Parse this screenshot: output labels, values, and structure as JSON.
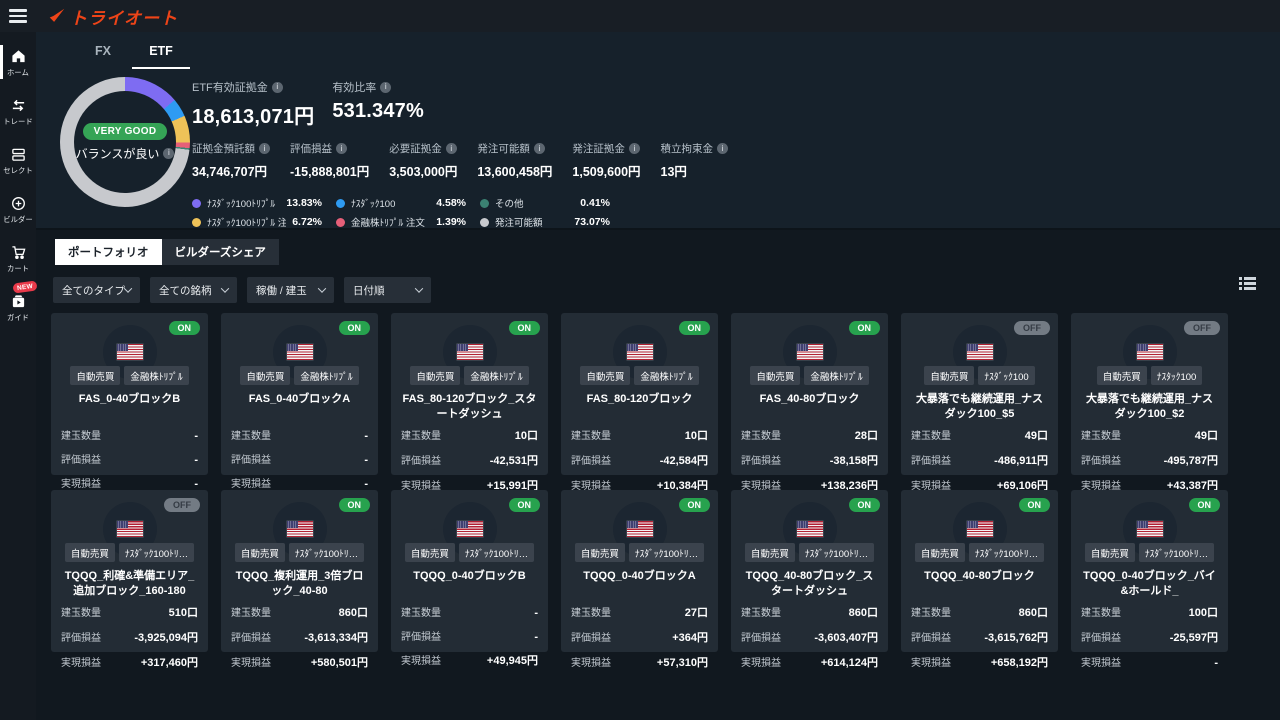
{
  "header": {
    "brand": "トライオート"
  },
  "sidebar": {
    "new_badge": "NEW",
    "items": [
      {
        "label": "ホーム"
      },
      {
        "label": "トレード"
      },
      {
        "label": "セレクト"
      },
      {
        "label": "ビルダー"
      },
      {
        "label": "カート"
      },
      {
        "label": "ガイド"
      }
    ]
  },
  "account": {
    "tabs": [
      {
        "label": "FX"
      },
      {
        "label": "ETF"
      }
    ],
    "gauge": {
      "badge": "VERY GOOD",
      "label": "バランスが良い"
    },
    "primary_stats": [
      {
        "label": "ETF有効証拠金",
        "value": "18,613,071円"
      },
      {
        "label": "有効比率",
        "value": "531.347%"
      }
    ],
    "secondary_stats": [
      {
        "label": "証拠金預託額",
        "value": "34,746,707円"
      },
      {
        "label": "評価損益",
        "value": "-15,888,801円"
      },
      {
        "label": "必要証拠金",
        "value": "3,503,000円"
      },
      {
        "label": "発注可能額",
        "value": "13,600,458円"
      },
      {
        "label": "発注証拠金",
        "value": "1,509,600円"
      },
      {
        "label": "積立拘束金",
        "value": "13円"
      }
    ],
    "legend": [
      {
        "label": "ﾅｽﾀﾞｯｸ100ﾄﾘﾌﾟﾙ",
        "value": "13.83%",
        "color": "#7e6cf2"
      },
      {
        "label": "ﾅｽﾀﾞｯｸ100ﾄﾘﾌﾟﾙ 注文",
        "value": "6.72%",
        "color": "#eec258"
      },
      {
        "label": "ﾅｽﾀﾞｯｸ100",
        "value": "4.58%",
        "color": "#2e9bf2"
      },
      {
        "label": "金融株ﾄﾘﾌﾟﾙ 注文",
        "value": "1.39%",
        "color": "#e55f78"
      },
      {
        "label": "その他",
        "value": "0.41%",
        "color": "#3b8172"
      },
      {
        "label": "発注可能額",
        "value": "73.07%",
        "color": "#c7c9cd"
      }
    ],
    "chart_data": {
      "type": "pie",
      "donut": true,
      "unit": "%",
      "center_badge": "VERY GOOD",
      "center_label": "バランスが良い",
      "segments": [
        {
          "label": "ﾅｽﾀﾞｯｸ100ﾄﾘﾌﾟﾙ",
          "value": 13.83,
          "color": "#7e6cf2"
        },
        {
          "label": "ﾅｽﾀﾞｯｸ100",
          "value": 4.58,
          "color": "#2e9bf2"
        },
        {
          "label": "ﾅｽﾀﾞｯｸ100ﾄﾘﾌﾟﾙ 注文",
          "value": 6.72,
          "color": "#eec258"
        },
        {
          "label": "金融株ﾄﾘﾌﾟﾙ 注文",
          "value": 1.39,
          "color": "#e55f78"
        },
        {
          "label": "その他",
          "value": 0.41,
          "color": "#3b8172"
        },
        {
          "label": "発注可能額",
          "value": 73.07,
          "color": "#c7c9cd"
        }
      ]
    }
  },
  "portfolio": {
    "tabs": [
      {
        "label": "ポートフォリオ"
      },
      {
        "label": "ビルダーズシェア"
      }
    ],
    "filters": [
      {
        "label": "全てのタイプ"
      },
      {
        "label": "全ての銘柄"
      },
      {
        "label": "稼働 / 建玉"
      },
      {
        "label": "日付順"
      }
    ],
    "auto_label": "自動売買",
    "stat_labels": {
      "qty": "建玉数量",
      "unrealized": "評価損益",
      "realized": "実現損益"
    },
    "cards": [
      {
        "status": "ON",
        "tag": "金融株ﾄﾘﾌﾟﾙ",
        "title": "FAS_0-40ブロックB",
        "qty": "-",
        "unrealized": "-",
        "realized": "-"
      },
      {
        "status": "ON",
        "tag": "金融株ﾄﾘﾌﾟﾙ",
        "title": "FAS_0-40ブロックA",
        "qty": "-",
        "unrealized": "-",
        "realized": "-"
      },
      {
        "status": "ON",
        "tag": "金融株ﾄﾘﾌﾟﾙ",
        "title": "FAS_80-120ブロック_スタートダッシュ",
        "qty": "10口",
        "unrealized": "-42,531円",
        "realized": "+15,991円"
      },
      {
        "status": "ON",
        "tag": "金融株ﾄﾘﾌﾟﾙ",
        "title": "FAS_80-120ブロック",
        "qty": "10口",
        "unrealized": "-42,584円",
        "realized": "+10,384円"
      },
      {
        "status": "ON",
        "tag": "金融株ﾄﾘﾌﾟﾙ",
        "title": "FAS_40-80ブロック",
        "qty": "28口",
        "unrealized": "-38,158円",
        "realized": "+138,236円"
      },
      {
        "status": "OFF",
        "tag": "ﾅｽﾀﾞｯｸ100",
        "title": "大暴落でも継続運用_ナスダック100_$5",
        "qty": "49口",
        "unrealized": "-486,911円",
        "realized": "+69,106円"
      },
      {
        "status": "OFF",
        "tag": "ﾅｽﾀｯｸ100",
        "title": "大暴落でも継続運用_ナスダック100_$2",
        "qty": "49口",
        "unrealized": "-495,787円",
        "realized": "+43,387円"
      },
      {
        "status": "OFF",
        "tag": "ﾅｽﾀﾞｯｸ100ﾄﾘ…",
        "title": "TQQQ_利確&準備エリア_追加ブロック_160-180",
        "qty": "510口",
        "unrealized": "-3,925,094円",
        "realized": "+317,460円"
      },
      {
        "status": "ON",
        "tag": "ﾅｽﾀﾞｯｸ100ﾄﾘ…",
        "title": "TQQQ_複利運用_3倍ブロック_40-80",
        "qty": "860口",
        "unrealized": "-3,613,334円",
        "realized": "+580,501円"
      },
      {
        "status": "ON",
        "tag": "ﾅｽﾀﾞｯｸ100ﾄﾘ…",
        "title": "TQQQ_0-40ブロックB",
        "qty": "-",
        "unrealized": "-",
        "realized": "+49,945円"
      },
      {
        "status": "ON",
        "tag": "ﾅｽﾀﾞｯｸ100ﾄﾘ…",
        "title": "TQQQ_0-40ブロックA",
        "qty": "27口",
        "unrealized": "+364円",
        "realized": "+57,310円"
      },
      {
        "status": "ON",
        "tag": "ﾅｽﾀﾞｯｸ100ﾄﾘ…",
        "title": "TQQQ_40-80ブロック_スタートダッシュ",
        "qty": "860口",
        "unrealized": "-3,603,407円",
        "realized": "+614,124円"
      },
      {
        "status": "ON",
        "tag": "ﾅｽﾀﾞｯｸ100ﾄﾘ…",
        "title": "TQQQ_40-80ブロック",
        "qty": "860口",
        "unrealized": "-3,615,762円",
        "realized": "+658,192円"
      },
      {
        "status": "ON",
        "tag": "ﾅｽﾀﾞｯｸ100ﾄﾘ…",
        "title": "TQQQ_0-40ブロック_バイ&ホールド_",
        "qty": "100口",
        "unrealized": "-25,597円",
        "realized": "-"
      }
    ]
  }
}
